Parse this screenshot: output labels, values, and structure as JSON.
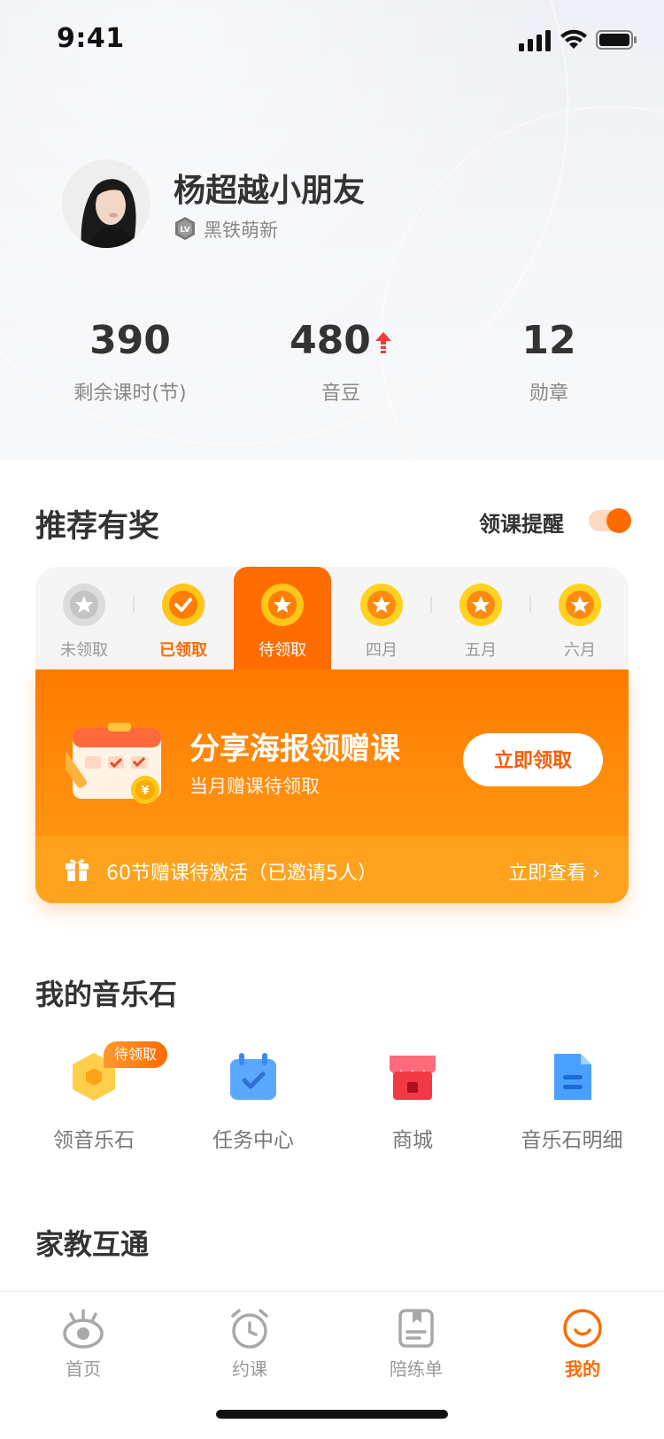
{
  "status_bar": {
    "time": "9:41"
  },
  "profile": {
    "name": "杨超越小朋友",
    "level_badge": "LV",
    "level_text": "黑铁萌新"
  },
  "stats": [
    {
      "value": "390",
      "label": "剩余课时(节)"
    },
    {
      "value": "480",
      "label": "音豆"
    },
    {
      "value": "12",
      "label": "勋章"
    }
  ],
  "rewards": {
    "title": "推荐有奖",
    "reminder_label": "领课提醒",
    "reminder_on": true,
    "tabs": [
      {
        "label": "未领取",
        "state": "unclaimed"
      },
      {
        "label": "已领取",
        "state": "claimed"
      },
      {
        "label": "待领取",
        "state": "active"
      },
      {
        "label": "四月",
        "state": "future"
      },
      {
        "label": "五月",
        "state": "future"
      },
      {
        "label": "六月",
        "state": "future"
      }
    ],
    "banner": {
      "title": "分享海报领赠课",
      "subtitle": "当月赠课待领取",
      "button": "立即领取",
      "invite_text": "60节赠课待激活（已邀请5人）",
      "view_link": "立即查看 ›"
    }
  },
  "music_stones": {
    "title": "我的音乐石",
    "badge": "待领取",
    "items": [
      {
        "label": "领音乐石",
        "icon": "hexagon-stone-icon"
      },
      {
        "label": "任务中心",
        "icon": "calendar-check-icon"
      },
      {
        "label": "商城",
        "icon": "store-icon"
      },
      {
        "label": "音乐石明细",
        "icon": "document-icon"
      }
    ]
  },
  "home_school": {
    "title": "家教互通"
  },
  "nav": [
    {
      "label": "首页",
      "icon": "eye-monster-icon"
    },
    {
      "label": "约课",
      "icon": "alarm-clock-icon"
    },
    {
      "label": "陪练单",
      "icon": "bookmark-list-icon"
    },
    {
      "label": "我的",
      "icon": "smiley-icon"
    }
  ],
  "colors": {
    "accent": "#ff6a00",
    "banner": "#ff8a0a"
  }
}
